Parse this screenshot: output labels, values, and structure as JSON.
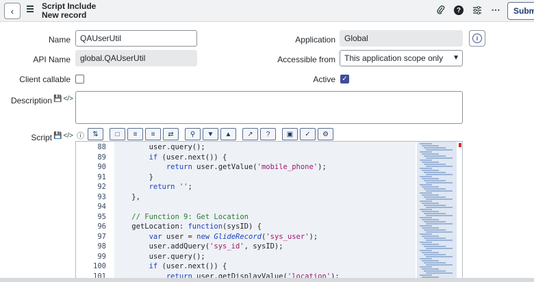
{
  "header": {
    "title_line1": "Script Include",
    "title_line2": "New record",
    "submit_label": "Submi"
  },
  "icons": {
    "back": "chevron-left-icon",
    "menu": "hamburger-icon",
    "attach": "paperclip-icon",
    "help": "help-icon",
    "settings": "sliders-icon",
    "more": "more-icon"
  },
  "form": {
    "name_label": "Name",
    "name_value": "QAUserUtil",
    "api_name_label": "API Name",
    "api_name_value": "global.QAUserUtil",
    "client_callable_label": "Client callable",
    "client_callable_checked": false,
    "description_label": "Description",
    "script_label": "Script",
    "application_label": "Application",
    "application_value": "Global",
    "accessible_from_label": "Accessible from",
    "accessible_from_value": "This application scope only",
    "active_label": "Active",
    "active_checked": true
  },
  "editor": {
    "lines": [
      {
        "n": "88",
        "code": "        user.query();"
      },
      {
        "n": "89",
        "code": "        if (user.next()) {"
      },
      {
        "n": "90",
        "code": "            return user.getValue('mobile_phone');"
      },
      {
        "n": "91",
        "code": "        }"
      },
      {
        "n": "92",
        "code": "        return '';"
      },
      {
        "n": "93",
        "code": "    },"
      },
      {
        "n": "94",
        "code": ""
      },
      {
        "n": "95",
        "code": "    // Function 9: Get Location"
      },
      {
        "n": "96",
        "code": "    getLocation: function(sysID) {"
      },
      {
        "n": "97",
        "code": "        var user = new GlideRecord('sys_user');"
      },
      {
        "n": "98",
        "code": "        user.addQuery('sys_id', sysID);"
      },
      {
        "n": "99",
        "code": "        user.query();"
      },
      {
        "n": "100",
        "code": "        if (user.next()) {"
      },
      {
        "n": "101",
        "code": "            return user.getDisplayValue('location');"
      }
    ]
  }
}
